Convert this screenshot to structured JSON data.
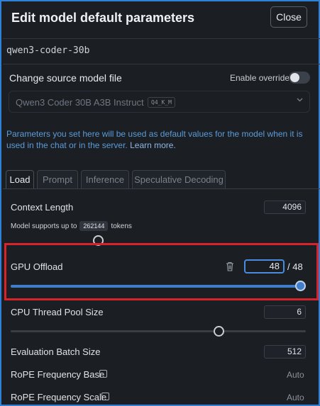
{
  "dialog": {
    "title": "Edit model default parameters",
    "close_label": "Close",
    "model_id": "qwen3-coder-30b"
  },
  "source": {
    "section_title": "Change source model file",
    "override_label": "Enable override",
    "override_enabled": false,
    "selected_model": "Qwen3 Coder 30B A3B Instruct",
    "quant_badge": "Q4_K_M"
  },
  "info": {
    "text": "Parameters you set here will be used as default values for the model when it is used in the chat or in the server.",
    "link": "Learn more."
  },
  "tabs": [
    "Load",
    "Prompt",
    "Inference",
    "Speculative Decoding"
  ],
  "active_tab": "Load",
  "params": {
    "context_length": {
      "label": "Context Length",
      "value": "4096",
      "hint_prefix": "Model supports up to",
      "hint_max": "262144",
      "hint_suffix": "tokens"
    },
    "gpu_offload": {
      "label": "GPU Offload",
      "value": "48",
      "max": "/ 48",
      "fraction": 1.0
    },
    "cpu_threads": {
      "label": "CPU Thread Pool Size",
      "value": "6"
    },
    "eval_batch": {
      "label": "Evaluation Batch Size",
      "value": "512"
    },
    "rope_base": {
      "label": "RoPE Frequency Base",
      "checked": false,
      "value": "Auto"
    },
    "rope_scale": {
      "label": "RoPE Frequency Scale",
      "checked": false,
      "value": "Auto"
    }
  },
  "colors": {
    "accent": "#3f7fca",
    "info_text": "#5b9bd8",
    "highlight": "#d9232b",
    "window_border": "#2f80d8"
  }
}
